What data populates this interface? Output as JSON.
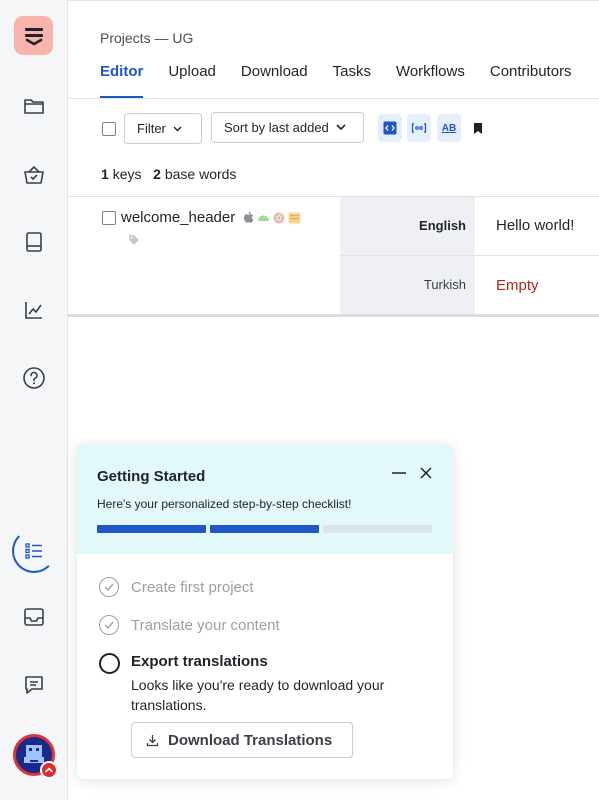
{
  "header": {
    "breadcrumb": "Projects — UG",
    "tabs": [
      {
        "label": "Editor",
        "active": true
      },
      {
        "label": "Upload"
      },
      {
        "label": "Download"
      },
      {
        "label": "Tasks"
      },
      {
        "label": "Workflows"
      },
      {
        "label": "Contributors"
      }
    ]
  },
  "sidebar": {
    "items": [
      {
        "icon": "logo-icon"
      },
      {
        "icon": "folder-icon"
      },
      {
        "icon": "basket-icon"
      },
      {
        "icon": "book-icon"
      },
      {
        "icon": "chart-icon"
      },
      {
        "icon": "help-icon"
      },
      {
        "icon": "checklist-icon",
        "active": true
      },
      {
        "icon": "inbox-icon"
      },
      {
        "icon": "chat-icon"
      }
    ]
  },
  "toolbar": {
    "filter_label": "Filter",
    "sort_label": "Sort by last added",
    "ab_label": "AB"
  },
  "counts": {
    "keys_count": "1",
    "keys_label": "keys",
    "base_words_count": "2",
    "base_words_label": "base words"
  },
  "key": {
    "name": "welcome_header",
    "translations": [
      {
        "language": "English",
        "value": "Hello world!"
      },
      {
        "language": "Turkish",
        "value": "Empty"
      }
    ]
  },
  "getting_started": {
    "title": "Getting Started",
    "subtitle": "Here's your personalized step-by-step checklist!",
    "progress": {
      "completed": 2,
      "total": 3
    },
    "steps": [
      {
        "label": "Create first project",
        "done": true
      },
      {
        "label": "Translate your content",
        "done": true
      },
      {
        "label": "Export translations",
        "done": false,
        "description": "Looks like you're ready to download your translations."
      }
    ],
    "download_button": "Download Translations"
  },
  "colors": {
    "accent": "#1d57c9",
    "empty_value": "#b3261e",
    "panel_header": "#e3f8f9"
  }
}
